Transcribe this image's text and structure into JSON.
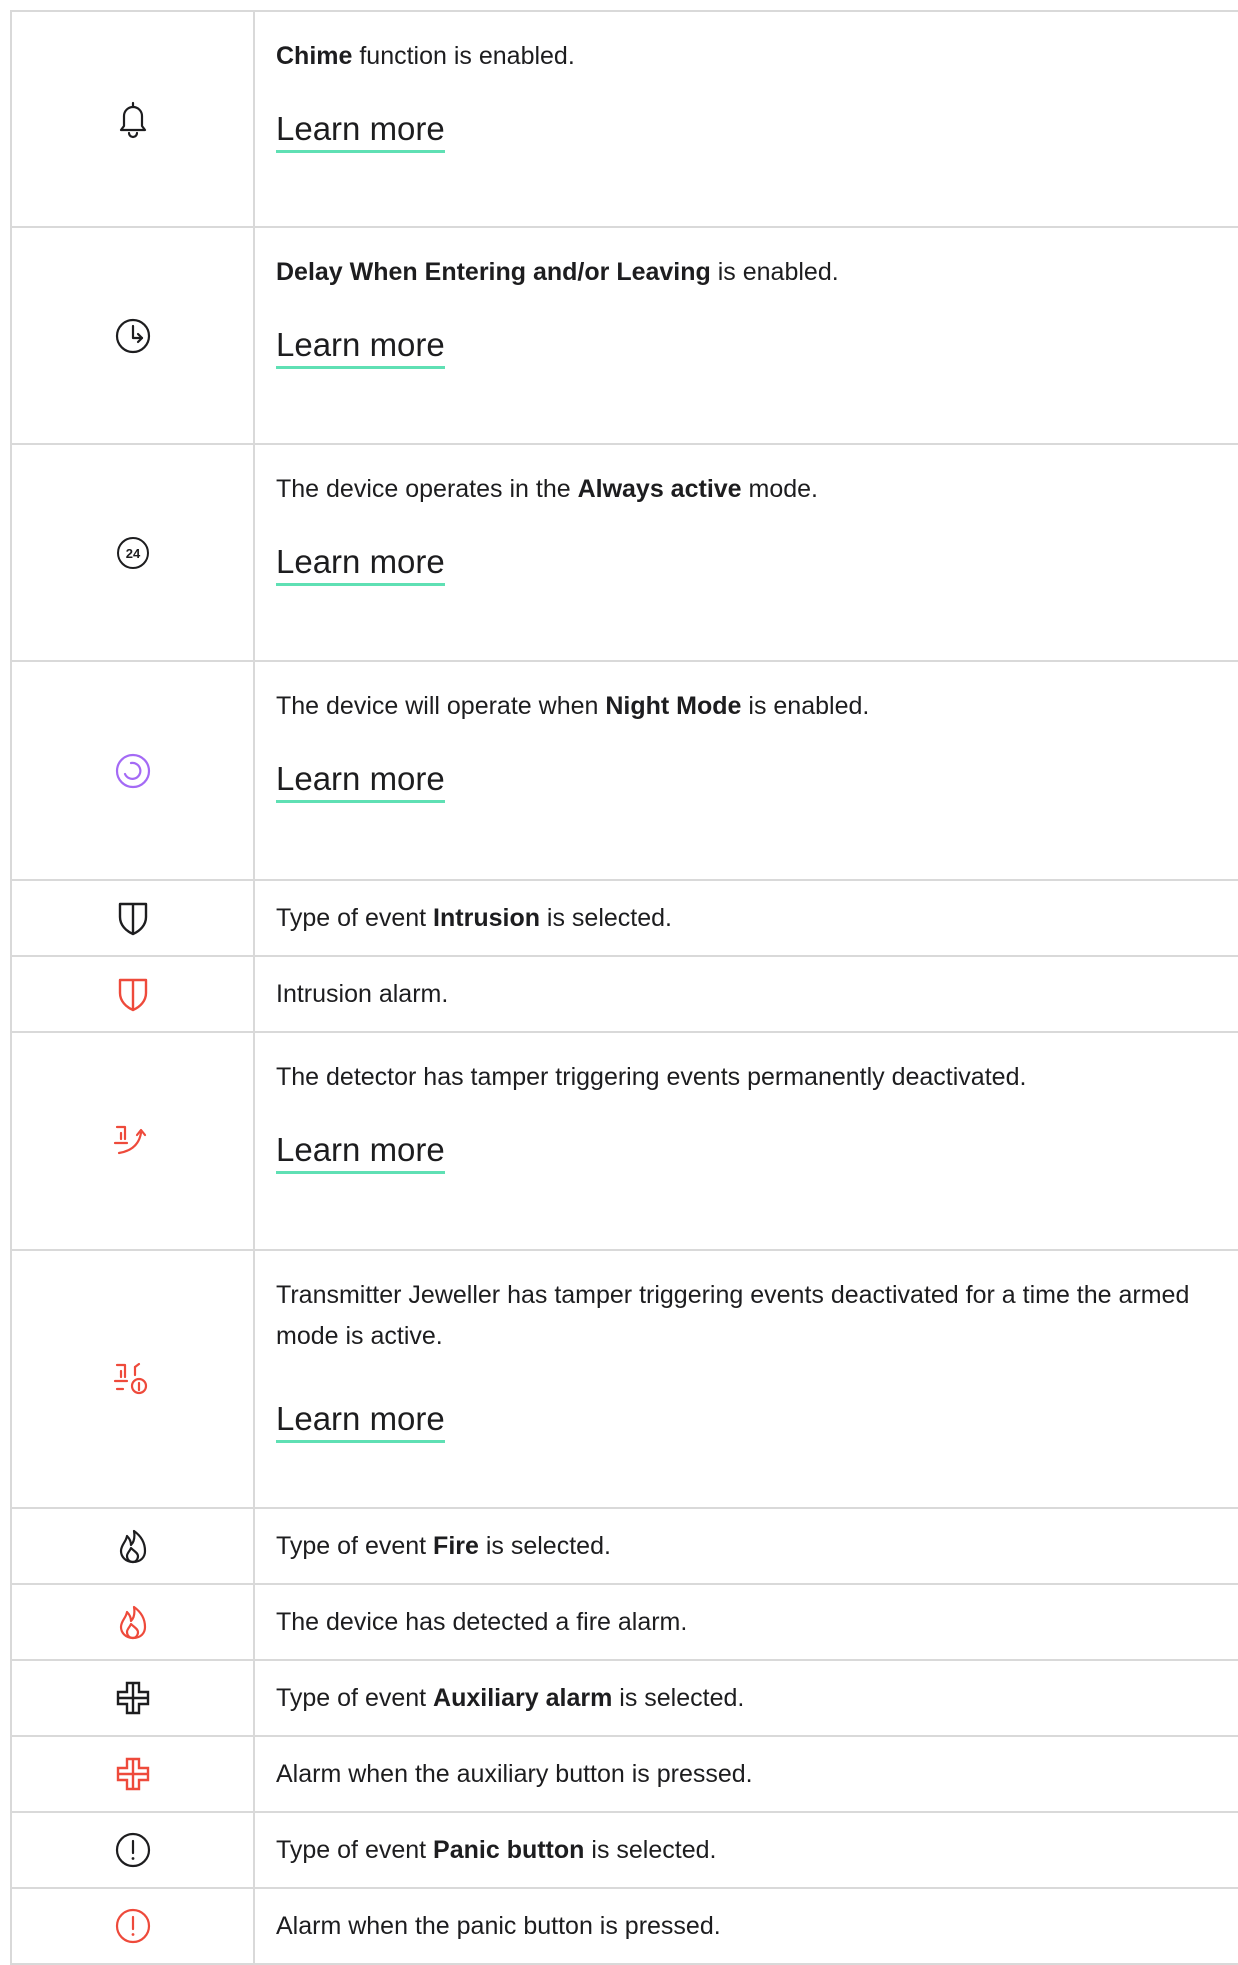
{
  "learn_more": "Learn more",
  "rows": [
    {
      "icon": "bell-icon",
      "color": "#1d1d1f",
      "pre": "",
      "bold": "Chime",
      "post": " function is enabled.",
      "link": true
    },
    {
      "icon": "clock-delay-icon",
      "color": "#1d1d1f",
      "pre": "",
      "bold": "Delay When Entering and/or Leaving",
      "post": " is enabled.",
      "link": true
    },
    {
      "icon": "always-active-24-icon",
      "color": "#1d1d1f",
      "pre": "The device operates in the ",
      "bold": "Always active",
      "post": " mode.",
      "link": true
    },
    {
      "icon": "night-mode-icon",
      "color": "#a46af5",
      "pre": "The device will operate when ",
      "bold": "Night Mode",
      "post": " is enabled.",
      "link": true
    },
    {
      "icon": "shield-icon",
      "color": "#1d1d1f",
      "pre": "Type of event ",
      "bold": "Intrusion",
      "post": " is selected.",
      "link": false
    },
    {
      "icon": "shield-alarm-icon",
      "color": "#ee4a3b",
      "pre": "Intrusion alarm.",
      "bold": "",
      "post": "",
      "link": false
    },
    {
      "icon": "tamper-off-icon",
      "color": "#ee4a3b",
      "pre": "The detector has tamper triggering events permanently deactivated.",
      "bold": "",
      "post": "",
      "link": true
    },
    {
      "icon": "tamper-off-once-icon",
      "color": "#ee4a3b",
      "pre": "Transmitter Jeweller has tamper triggering events deactivated for a time the armed mode is active.",
      "bold": "",
      "post": "",
      "link": true
    },
    {
      "icon": "fire-icon",
      "color": "#1d1d1f",
      "pre": "Type of event ",
      "bold": "Fire",
      "post": " is selected.",
      "link": false
    },
    {
      "icon": "fire-alarm-icon",
      "color": "#ee4a3b",
      "pre": "The device has detected a fire alarm.",
      "bold": "",
      "post": "",
      "link": false
    },
    {
      "icon": "auxiliary-cross-icon",
      "color": "#1d1d1f",
      "pre": "Type of event ",
      "bold": "Auxiliary alarm",
      "post": " is selected.",
      "link": false
    },
    {
      "icon": "auxiliary-alarm-icon",
      "color": "#ee4a3b",
      "pre": "Alarm when the auxiliary button is pressed.",
      "bold": "",
      "post": "",
      "link": false
    },
    {
      "icon": "panic-icon",
      "color": "#1d1d1f",
      "pre": "Type of event ",
      "bold": "Panic button",
      "post": " is selected.",
      "link": false
    },
    {
      "icon": "panic-alarm-icon",
      "color": "#ee4a3b",
      "pre": "Alarm when the panic button is pressed.",
      "bold": "",
      "post": "",
      "link": false
    }
  ]
}
